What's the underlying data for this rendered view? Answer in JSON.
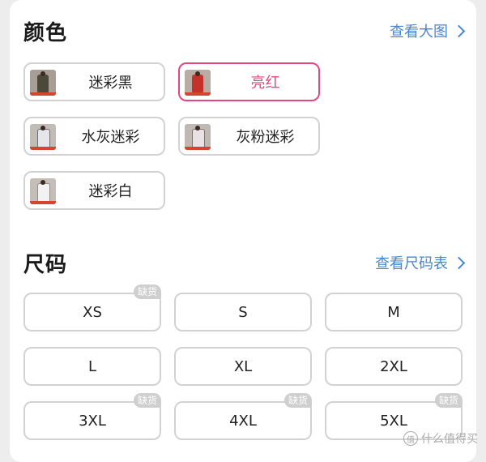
{
  "colors": {
    "title": "颜色",
    "view_link": "查看大图",
    "options": [
      {
        "label": "迷彩黑",
        "selected": false
      },
      {
        "label": "亮红",
        "selected": true
      },
      {
        "label": "水灰迷彩",
        "selected": false
      },
      {
        "label": "灰粉迷彩",
        "selected": false
      },
      {
        "label": "迷彩白",
        "selected": false
      }
    ]
  },
  "sizes": {
    "title": "尺码",
    "chart_link": "查看尺码表",
    "options": [
      {
        "label": "XS",
        "badge": "缺货"
      },
      {
        "label": "S",
        "badge": ""
      },
      {
        "label": "M",
        "badge": ""
      },
      {
        "label": "L",
        "badge": ""
      },
      {
        "label": "XL",
        "badge": ""
      },
      {
        "label": "2XL",
        "badge": ""
      },
      {
        "label": "3XL",
        "badge": "缺货"
      },
      {
        "label": "4XL",
        "badge": "缺货"
      },
      {
        "label": "5XL",
        "badge": "缺货"
      }
    ]
  },
  "watermark": "值 什么值得买",
  "accent_color": "#e8457a",
  "link_color": "#4a86cf"
}
